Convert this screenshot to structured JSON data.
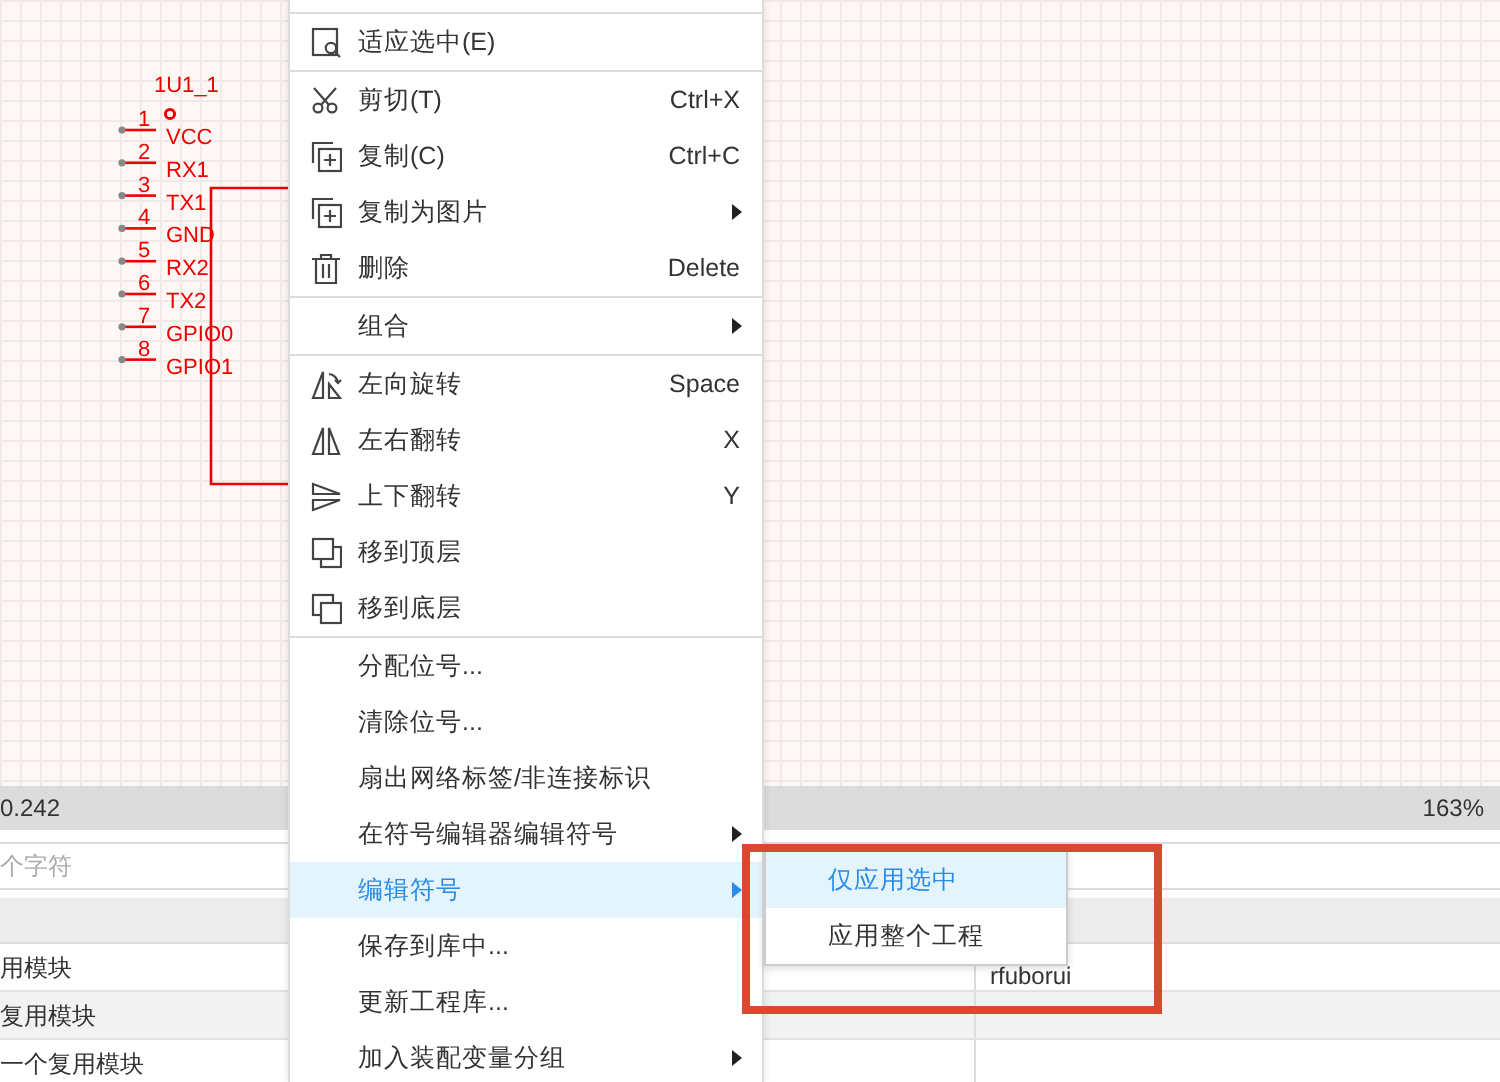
{
  "schematic": {
    "designator": "1U1_1",
    "pins": [
      {
        "number": "1",
        "name": "VCC"
      },
      {
        "number": "2",
        "name": "RX1"
      },
      {
        "number": "3",
        "name": "TX1"
      },
      {
        "number": "4",
        "name": "GND"
      },
      {
        "number": "5",
        "name": "RX2"
      },
      {
        "number": "6",
        "name": "TX2"
      },
      {
        "number": "7",
        "name": "GPIO0"
      },
      {
        "number": "8",
        "name": "GPIO1"
      }
    ]
  },
  "status_bar": {
    "coordinate": "0.242",
    "zoom": "163%"
  },
  "panel": {
    "search": {
      "placeholder": "个字符"
    },
    "rows": [
      {
        "column_1": "用模块",
        "column_2": "rfuborui"
      },
      {
        "column_1": "复用模块",
        "column_2": ""
      },
      {
        "column_1": "一个复用模块",
        "column_2": ""
      }
    ]
  },
  "context_menu": {
    "items": [
      {
        "kind": "separator"
      },
      {
        "kind": "item",
        "label": "适应选中(E)",
        "selected": false
      },
      {
        "kind": "separator"
      },
      {
        "kind": "item",
        "label": "剪切(T)",
        "shortcut": "Ctrl+X",
        "selected": false
      },
      {
        "kind": "item",
        "label": "复制(C)",
        "shortcut": "Ctrl+C",
        "selected": false
      },
      {
        "kind": "item",
        "label": "复制为图片",
        "submenu": true,
        "selected": false
      },
      {
        "kind": "item",
        "label": "删除",
        "shortcut": "Delete",
        "selected": false
      },
      {
        "kind": "separator"
      },
      {
        "kind": "item",
        "label": "组合",
        "submenu": true,
        "selected": false
      },
      {
        "kind": "separator"
      },
      {
        "kind": "item",
        "label": "左向旋转",
        "shortcut": "Space",
        "selected": false
      },
      {
        "kind": "item",
        "label": "左右翻转",
        "shortcut": "X",
        "selected": false
      },
      {
        "kind": "item",
        "label": "上下翻转",
        "shortcut": "Y",
        "selected": false
      },
      {
        "kind": "item",
        "label": "移到顶层",
        "selected": false
      },
      {
        "kind": "item",
        "label": "移到底层",
        "selected": false
      },
      {
        "kind": "separator"
      },
      {
        "kind": "item",
        "label": "分配位号...",
        "selected": false
      },
      {
        "kind": "item",
        "label": "清除位号...",
        "selected": false
      },
      {
        "kind": "item",
        "label": "扇出网络标签/非连接标识",
        "selected": false
      },
      {
        "kind": "item",
        "label": "在符号编辑器编辑符号",
        "submenu": true,
        "selected": false
      },
      {
        "kind": "item",
        "label": "编辑符号",
        "submenu": true,
        "selected": true
      },
      {
        "kind": "item",
        "label": "保存到库中...",
        "selected": false
      },
      {
        "kind": "item",
        "label": "更新工程库...",
        "selected": false
      },
      {
        "kind": "item",
        "label": "加入装配变量分组",
        "submenu": true,
        "selected": false
      }
    ]
  },
  "submenu": {
    "items": [
      {
        "label": "仅应用选中",
        "selected": true
      },
      {
        "label": "应用整个工程",
        "selected": false
      }
    ]
  }
}
